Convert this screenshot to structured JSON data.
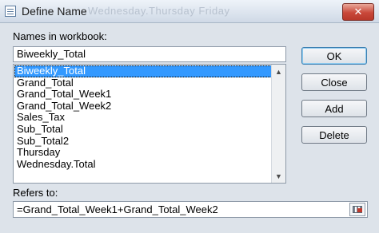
{
  "window": {
    "title": "Define Name",
    "background_ghost_text": "Wednesday.Thursday  Friday",
    "close_glyph": "✕"
  },
  "names_label": "Names in workbook:",
  "name_input": {
    "value": "Biweekly_Total"
  },
  "names_list": {
    "items": [
      "Biweekly_Total",
      "Grand_Total",
      "Grand_Total_Week1",
      "Grand_Total_Week2",
      "Sales_Tax",
      "Sub_Total",
      "Sub_Total2",
      "Thursday",
      "Wednesday.Total"
    ],
    "selected_index": 0
  },
  "buttons": {
    "ok": "OK",
    "close": "Close",
    "add": "Add",
    "delete": "Delete"
  },
  "refers_label": "Refers to:",
  "refers_input": {
    "value": "=Grand_Total_Week1+Grand_Total_Week2"
  },
  "colors": {
    "selection": "#3399ff",
    "close_button": "#c9483a",
    "default_button_border": "#3c7fb1"
  },
  "icons": {
    "title": "dialog-icon",
    "collapse": "range-collapse-icon",
    "scroll_up": "chevron-up-icon",
    "scroll_down": "chevron-down-icon"
  }
}
